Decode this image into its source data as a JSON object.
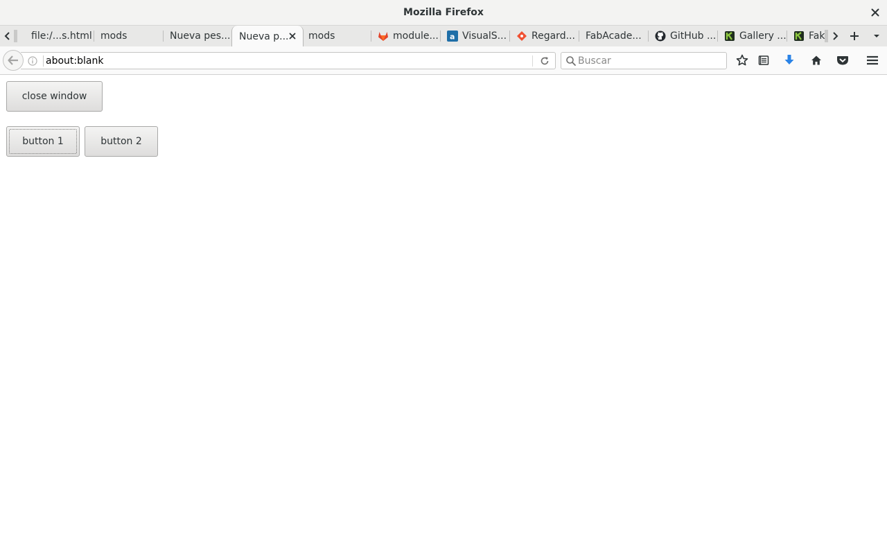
{
  "window": {
    "title": "Mozilla Firefox"
  },
  "tabs": [
    {
      "label": "file:/...s.html",
      "icon": "none"
    },
    {
      "label": "mods",
      "icon": "none"
    },
    {
      "label": "Nueva pes...",
      "icon": "none"
    },
    {
      "label": "Nueva p...",
      "icon": "none",
      "active": true
    },
    {
      "label": "mods",
      "icon": "none"
    },
    {
      "label": "module...",
      "icon": "gitlab-icon"
    },
    {
      "label": "VisualS...",
      "icon": "a-box-icon"
    },
    {
      "label": "Regard...",
      "icon": "git-diamond-icon"
    },
    {
      "label": "FabAcade...",
      "icon": "none"
    },
    {
      "label": "GitHub ...",
      "icon": "github-icon"
    },
    {
      "label": "Gallery ...",
      "icon": "k-logo-icon"
    },
    {
      "label": "Fake",
      "icon": "k-logo-icon"
    }
  ],
  "navbar": {
    "url": "about:blank",
    "search_placeholder": "Buscar"
  },
  "content": {
    "close_label": "close window",
    "button1_label": "button 1",
    "button2_label": "button 2"
  },
  "colors": {
    "download_accent": "#2a83e6",
    "gitlab_orange": "#e2432a",
    "git_orange": "#f05133",
    "visualstudio_blue": "#1e6ea7"
  }
}
